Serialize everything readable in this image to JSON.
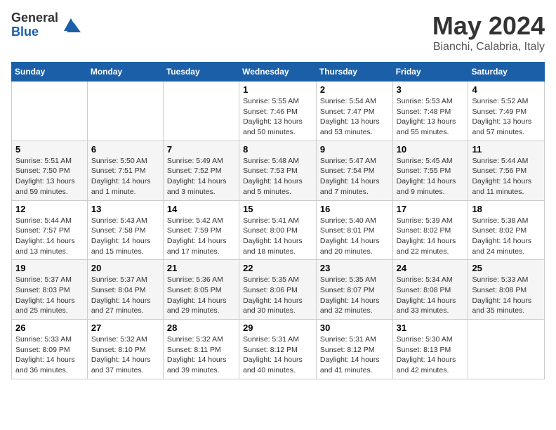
{
  "header": {
    "logo_general": "General",
    "logo_blue": "Blue",
    "month_title": "May 2024",
    "location": "Bianchi, Calabria, Italy"
  },
  "weekdays": [
    "Sunday",
    "Monday",
    "Tuesday",
    "Wednesday",
    "Thursday",
    "Friday",
    "Saturday"
  ],
  "weeks": [
    [
      {
        "day": "",
        "sunrise": "",
        "sunset": "",
        "daylight": ""
      },
      {
        "day": "",
        "sunrise": "",
        "sunset": "",
        "daylight": ""
      },
      {
        "day": "",
        "sunrise": "",
        "sunset": "",
        "daylight": ""
      },
      {
        "day": "1",
        "sunrise": "Sunrise: 5:55 AM",
        "sunset": "Sunset: 7:46 PM",
        "daylight": "Daylight: 13 hours and 50 minutes."
      },
      {
        "day": "2",
        "sunrise": "Sunrise: 5:54 AM",
        "sunset": "Sunset: 7:47 PM",
        "daylight": "Daylight: 13 hours and 53 minutes."
      },
      {
        "day": "3",
        "sunrise": "Sunrise: 5:53 AM",
        "sunset": "Sunset: 7:48 PM",
        "daylight": "Daylight: 13 hours and 55 minutes."
      },
      {
        "day": "4",
        "sunrise": "Sunrise: 5:52 AM",
        "sunset": "Sunset: 7:49 PM",
        "daylight": "Daylight: 13 hours and 57 minutes."
      }
    ],
    [
      {
        "day": "5",
        "sunrise": "Sunrise: 5:51 AM",
        "sunset": "Sunset: 7:50 PM",
        "daylight": "Daylight: 13 hours and 59 minutes."
      },
      {
        "day": "6",
        "sunrise": "Sunrise: 5:50 AM",
        "sunset": "Sunset: 7:51 PM",
        "daylight": "Daylight: 14 hours and 1 minute."
      },
      {
        "day": "7",
        "sunrise": "Sunrise: 5:49 AM",
        "sunset": "Sunset: 7:52 PM",
        "daylight": "Daylight: 14 hours and 3 minutes."
      },
      {
        "day": "8",
        "sunrise": "Sunrise: 5:48 AM",
        "sunset": "Sunset: 7:53 PM",
        "daylight": "Daylight: 14 hours and 5 minutes."
      },
      {
        "day": "9",
        "sunrise": "Sunrise: 5:47 AM",
        "sunset": "Sunset: 7:54 PM",
        "daylight": "Daylight: 14 hours and 7 minutes."
      },
      {
        "day": "10",
        "sunrise": "Sunrise: 5:45 AM",
        "sunset": "Sunset: 7:55 PM",
        "daylight": "Daylight: 14 hours and 9 minutes."
      },
      {
        "day": "11",
        "sunrise": "Sunrise: 5:44 AM",
        "sunset": "Sunset: 7:56 PM",
        "daylight": "Daylight: 14 hours and 11 minutes."
      }
    ],
    [
      {
        "day": "12",
        "sunrise": "Sunrise: 5:44 AM",
        "sunset": "Sunset: 7:57 PM",
        "daylight": "Daylight: 14 hours and 13 minutes."
      },
      {
        "day": "13",
        "sunrise": "Sunrise: 5:43 AM",
        "sunset": "Sunset: 7:58 PM",
        "daylight": "Daylight: 14 hours and 15 minutes."
      },
      {
        "day": "14",
        "sunrise": "Sunrise: 5:42 AM",
        "sunset": "Sunset: 7:59 PM",
        "daylight": "Daylight: 14 hours and 17 minutes."
      },
      {
        "day": "15",
        "sunrise": "Sunrise: 5:41 AM",
        "sunset": "Sunset: 8:00 PM",
        "daylight": "Daylight: 14 hours and 18 minutes."
      },
      {
        "day": "16",
        "sunrise": "Sunrise: 5:40 AM",
        "sunset": "Sunset: 8:01 PM",
        "daylight": "Daylight: 14 hours and 20 minutes."
      },
      {
        "day": "17",
        "sunrise": "Sunrise: 5:39 AM",
        "sunset": "Sunset: 8:02 PM",
        "daylight": "Daylight: 14 hours and 22 minutes."
      },
      {
        "day": "18",
        "sunrise": "Sunrise: 5:38 AM",
        "sunset": "Sunset: 8:02 PM",
        "daylight": "Daylight: 14 hours and 24 minutes."
      }
    ],
    [
      {
        "day": "19",
        "sunrise": "Sunrise: 5:37 AM",
        "sunset": "Sunset: 8:03 PM",
        "daylight": "Daylight: 14 hours and 25 minutes."
      },
      {
        "day": "20",
        "sunrise": "Sunrise: 5:37 AM",
        "sunset": "Sunset: 8:04 PM",
        "daylight": "Daylight: 14 hours and 27 minutes."
      },
      {
        "day": "21",
        "sunrise": "Sunrise: 5:36 AM",
        "sunset": "Sunset: 8:05 PM",
        "daylight": "Daylight: 14 hours and 29 minutes."
      },
      {
        "day": "22",
        "sunrise": "Sunrise: 5:35 AM",
        "sunset": "Sunset: 8:06 PM",
        "daylight": "Daylight: 14 hours and 30 minutes."
      },
      {
        "day": "23",
        "sunrise": "Sunrise: 5:35 AM",
        "sunset": "Sunset: 8:07 PM",
        "daylight": "Daylight: 14 hours and 32 minutes."
      },
      {
        "day": "24",
        "sunrise": "Sunrise: 5:34 AM",
        "sunset": "Sunset: 8:08 PM",
        "daylight": "Daylight: 14 hours and 33 minutes."
      },
      {
        "day": "25",
        "sunrise": "Sunrise: 5:33 AM",
        "sunset": "Sunset: 8:08 PM",
        "daylight": "Daylight: 14 hours and 35 minutes."
      }
    ],
    [
      {
        "day": "26",
        "sunrise": "Sunrise: 5:33 AM",
        "sunset": "Sunset: 8:09 PM",
        "daylight": "Daylight: 14 hours and 36 minutes."
      },
      {
        "day": "27",
        "sunrise": "Sunrise: 5:32 AM",
        "sunset": "Sunset: 8:10 PM",
        "daylight": "Daylight: 14 hours and 37 minutes."
      },
      {
        "day": "28",
        "sunrise": "Sunrise: 5:32 AM",
        "sunset": "Sunset: 8:11 PM",
        "daylight": "Daylight: 14 hours and 39 minutes."
      },
      {
        "day": "29",
        "sunrise": "Sunrise: 5:31 AM",
        "sunset": "Sunset: 8:12 PM",
        "daylight": "Daylight: 14 hours and 40 minutes."
      },
      {
        "day": "30",
        "sunrise": "Sunrise: 5:31 AM",
        "sunset": "Sunset: 8:12 PM",
        "daylight": "Daylight: 14 hours and 41 minutes."
      },
      {
        "day": "31",
        "sunrise": "Sunrise: 5:30 AM",
        "sunset": "Sunset: 8:13 PM",
        "daylight": "Daylight: 14 hours and 42 minutes."
      },
      {
        "day": "",
        "sunrise": "",
        "sunset": "",
        "daylight": ""
      }
    ]
  ]
}
